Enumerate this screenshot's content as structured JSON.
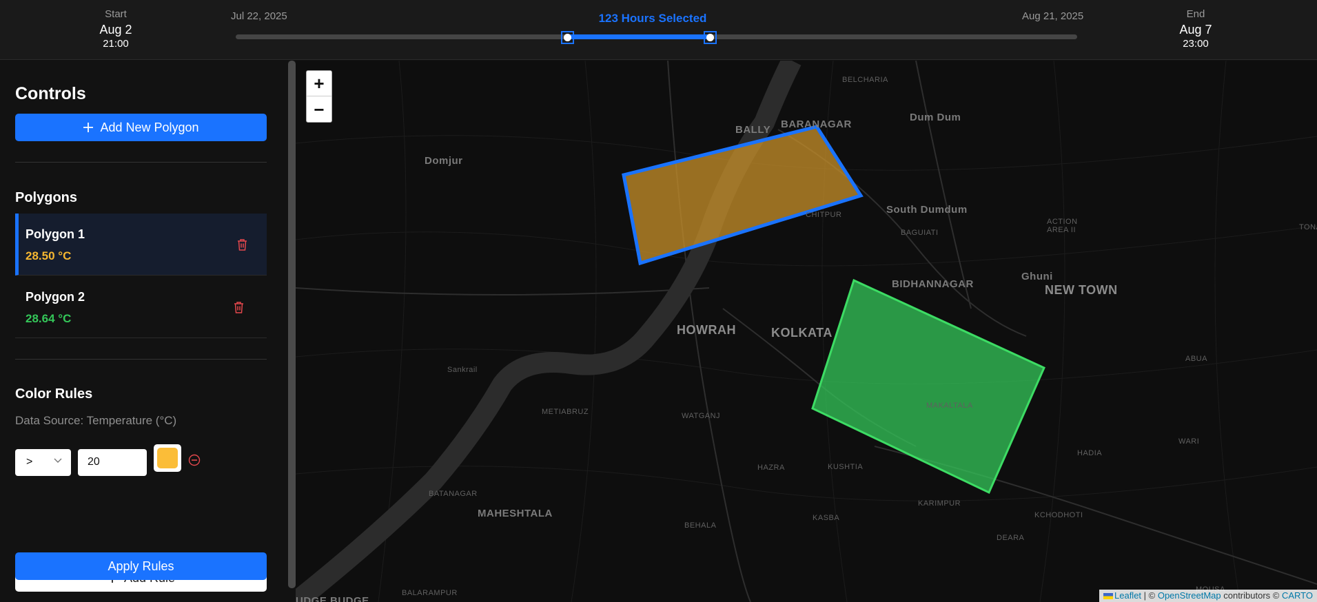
{
  "timeline": {
    "start_label": "Start",
    "start_date": "Aug 2",
    "start_time": "21:00",
    "range_start": "Jul 22, 2025",
    "selected_label": "123 Hours Selected",
    "range_end": "Aug 21, 2025",
    "end_label": "End",
    "end_date": "Aug 7",
    "end_time": "23:00",
    "selection_fraction": [
      0.394,
      0.564
    ],
    "accent_color": "#1a73ff"
  },
  "sidebar": {
    "title": "Controls",
    "add_polygon_label": "Add New Polygon",
    "polygons_title": "Polygons",
    "polygons": [
      {
        "name": "Polygon 1",
        "value": "28.50 °C",
        "color": "#f5b731",
        "selected": true
      },
      {
        "name": "Polygon 2",
        "value": "28.64 °C",
        "color": "#34c759",
        "selected": false
      }
    ],
    "color_rules_title": "Color Rules",
    "data_source": "Data Source: Temperature (°C)",
    "rules": [
      {
        "operator": ">",
        "value": "20",
        "color": "#fbbd38"
      }
    ],
    "add_rule_label": "Add Rule",
    "apply_label": "Apply Rules"
  },
  "map": {
    "zoom_in": "+",
    "zoom_out": "−",
    "labels": {
      "belcharia": "BELCHARIA",
      "dum_dum": "Dum Dum",
      "bally": "BALLY",
      "baranagar": "BARANAGAR",
      "domjur": "Domjur",
      "south_dumdum": "South Dumdum",
      "chitpur": "CHITPUR",
      "baguiati": "BAGUIATI",
      "action_area": "ACTION",
      "action_area2": "AREA II",
      "tona": "TONA",
      "ghuni": "Ghuni",
      "bidhannagar": "BIDHANNAGAR",
      "new_town": "NEW TOWN",
      "howrah": "HOWRAH",
      "kolkata": "KOLKATA",
      "sankrail": "Sankrail",
      "abua": "ABUA",
      "metiabruz": "METIABRUZ",
      "watganj": "WATGANJ",
      "makaltala": "MAKALTALA",
      "hadia": "HADIA",
      "wari": "WARI",
      "hazra": "HAZRA",
      "kushtia": "KUSHTIA",
      "batanagar": "BATANAGAR",
      "karimpur": "KARIMPUR",
      "kchodhoti": "KCHODHOTI",
      "maheshtala": "MAHESHTALA",
      "behala": "BEHALA",
      "kasba": "KASBA",
      "deara": "DEARA",
      "balarampur": "BALARAMPUR",
      "budge_budge": "UDGE BUDGE",
      "mouza": "MOUSA"
    },
    "attribution": {
      "leaflet": "Leaflet",
      "sep": " | © ",
      "osm": "OpenStreetMap",
      "contrib": " contributors © ",
      "carto": "CARTO"
    }
  }
}
